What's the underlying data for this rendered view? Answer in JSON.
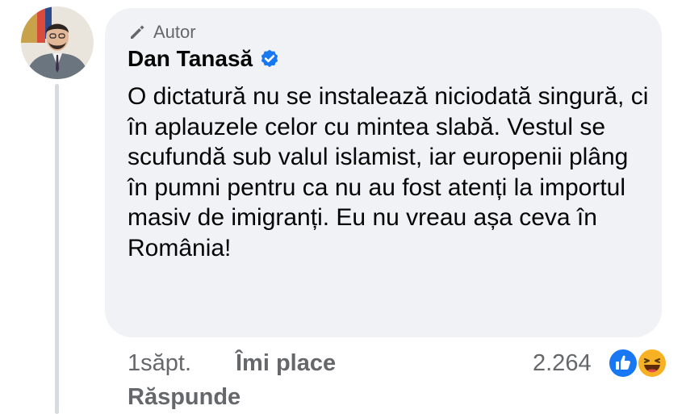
{
  "comment": {
    "author_badge": "Autor",
    "author_name": "Dan Tanasă",
    "text": "O dictatură nu se instalează niciodată singură, ci în aplauzele celor cu mintea slabă. Vestul se scufundă sub valul islamist, iar europenii plâng în pumni pentru ca nu au fost atenți la importul masiv de imigranți. Eu nu vreau așa ceva în România!",
    "time": "1săpt.",
    "like_label": "Îmi place",
    "reply_label": "Răspunde",
    "reaction_count": "2.264",
    "reactions": [
      "like-icon",
      "haha-icon"
    ],
    "badge_icon": "pencil-icon",
    "verified_icon": "verified-badge-icon"
  },
  "colors": {
    "bubble_bg": "#f0f2f5",
    "secondary_text": "#65676b",
    "primary_text": "#050505",
    "verified_blue": "#1877f2",
    "thread_line": "#d7dade"
  }
}
